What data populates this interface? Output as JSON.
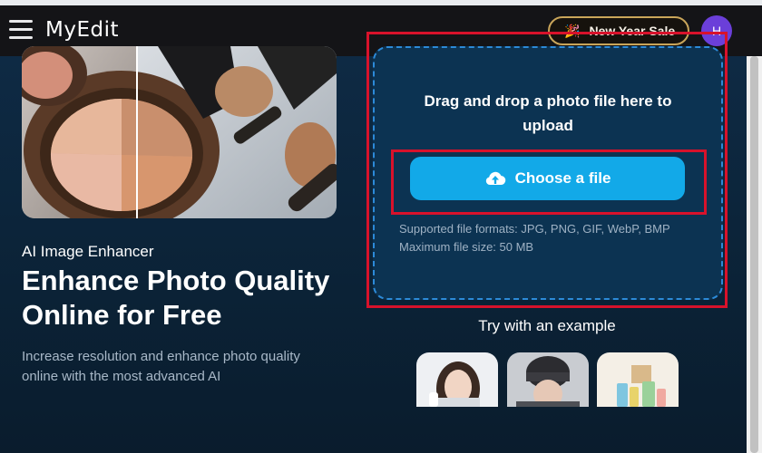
{
  "header": {
    "logo": "MyEdit",
    "sale_label": "New Year Sale",
    "avatar_initial": "H"
  },
  "hero": {
    "subtitle": "AI Image Enhancer",
    "title": "Enhance Photo Quality Online for Free",
    "description": "Increase resolution and enhance photo quality online with the most advanced AI"
  },
  "upload": {
    "instruction": "Drag and drop a photo file here to upload",
    "button_label": "Choose a file",
    "formats": "Supported file formats: JPG, PNG, GIF, WebP, BMP",
    "max_size": "Maximum file size: 50 MB"
  },
  "examples": {
    "title": "Try with an example"
  },
  "icons": {
    "menu": "hamburger-menu-icon",
    "sale": "party-popper-icon",
    "upload": "cloud-upload-icon"
  },
  "colors": {
    "accent": "#12a9e8",
    "annotation": "#d8122b",
    "avatar": "#6b3fd9",
    "sale_border": "#c9a55a"
  }
}
